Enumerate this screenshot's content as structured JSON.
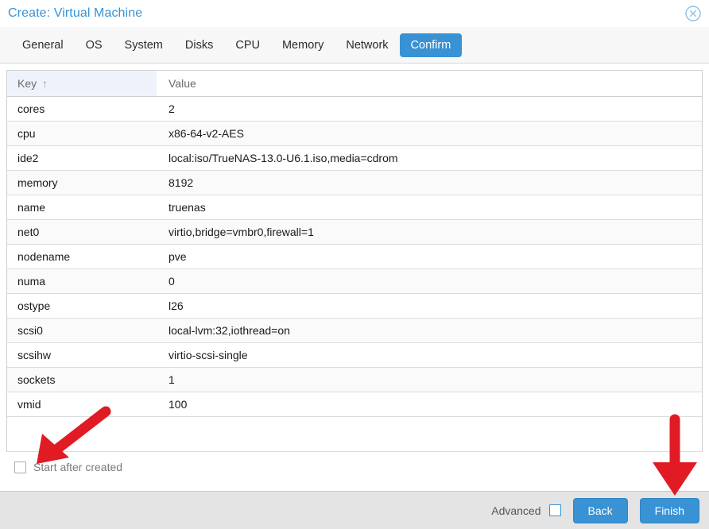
{
  "window": {
    "title": "Create: Virtual Machine",
    "close_icon": "close-circle-icon",
    "title_color": "#3892d4"
  },
  "tabs": [
    {
      "label": "General",
      "active": false
    },
    {
      "label": "OS",
      "active": false
    },
    {
      "label": "System",
      "active": false
    },
    {
      "label": "Disks",
      "active": false
    },
    {
      "label": "CPU",
      "active": false
    },
    {
      "label": "Memory",
      "active": false
    },
    {
      "label": "Network",
      "active": false
    },
    {
      "label": "Confirm",
      "active": true
    }
  ],
  "table": {
    "columns": [
      {
        "label": "Key",
        "sorted": true,
        "sort_icon": "sort-ascending-arrow",
        "sort_glyph": "↑"
      },
      {
        "label": "Value",
        "sorted": false
      }
    ],
    "rows": [
      {
        "key": "cores",
        "value": "2"
      },
      {
        "key": "cpu",
        "value": "x86-64-v2-AES"
      },
      {
        "key": "ide2",
        "value": "local:iso/TrueNAS-13.0-U6.1.iso,media=cdrom"
      },
      {
        "key": "memory",
        "value": "8192"
      },
      {
        "key": "name",
        "value": "truenas"
      },
      {
        "key": "net0",
        "value": "virtio,bridge=vmbr0,firewall=1"
      },
      {
        "key": "nodename",
        "value": "pve"
      },
      {
        "key": "numa",
        "value": "0"
      },
      {
        "key": "ostype",
        "value": "l26"
      },
      {
        "key": "scsi0",
        "value": "local-lvm:32,iothread=on"
      },
      {
        "key": "scsihw",
        "value": "virtio-scsi-single"
      },
      {
        "key": "sockets",
        "value": "1"
      },
      {
        "key": "vmid",
        "value": "100"
      }
    ]
  },
  "start_after_created": {
    "label": "Start after created",
    "checked": false
  },
  "footer": {
    "advanced_label": "Advanced",
    "advanced_checked": false,
    "back_label": "Back",
    "finish_label": "Finish"
  },
  "annotations": [
    {
      "name": "arrow-to-start-after-created",
      "color": "#e01b24",
      "direction": "down-left"
    },
    {
      "name": "arrow-to-finish-button",
      "color": "#e01b24",
      "direction": "down"
    }
  ],
  "colors": {
    "accent": "#3892d4",
    "annotation_red": "#e01b24",
    "row_alt": "#fafafa",
    "footer_bg": "#e4e4e4",
    "sorted_header_bg": "#eef3fb"
  }
}
